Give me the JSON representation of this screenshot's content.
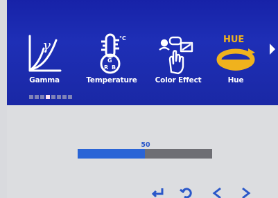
{
  "menu": {
    "items": [
      {
        "label": "Gamma",
        "icon": "gamma-curve-icon"
      },
      {
        "label": "Temperature",
        "icon": "thermometer-icon"
      },
      {
        "label": "Color Effect",
        "icon": "color-effect-hand-icon"
      },
      {
        "label": "Hue",
        "icon": "hue-rotate-icon",
        "selected": true
      }
    ],
    "next_icon": "chevron-right-icon",
    "page_dots": {
      "count": 8,
      "active_index": 3
    }
  },
  "hue": {
    "value": "50",
    "level": 0.5
  },
  "bottom_nav": {
    "buttons": [
      "enter-icon",
      "back-icon",
      "left-arrow-icon",
      "right-arrow-icon"
    ]
  },
  "icon_text": {
    "gamma_symbol": "γ",
    "temp_unit": "°C",
    "temp_g": "G",
    "temp_r": "R",
    "temp_b": "B",
    "hue_logo": "HUE"
  },
  "colors": {
    "menu_bg": "#1722a8",
    "selected_icon": "#f0b21d",
    "slider_fill": "#2a64d6",
    "slider_track": "#6e6e74",
    "panel_bg": "#dcdde0"
  }
}
